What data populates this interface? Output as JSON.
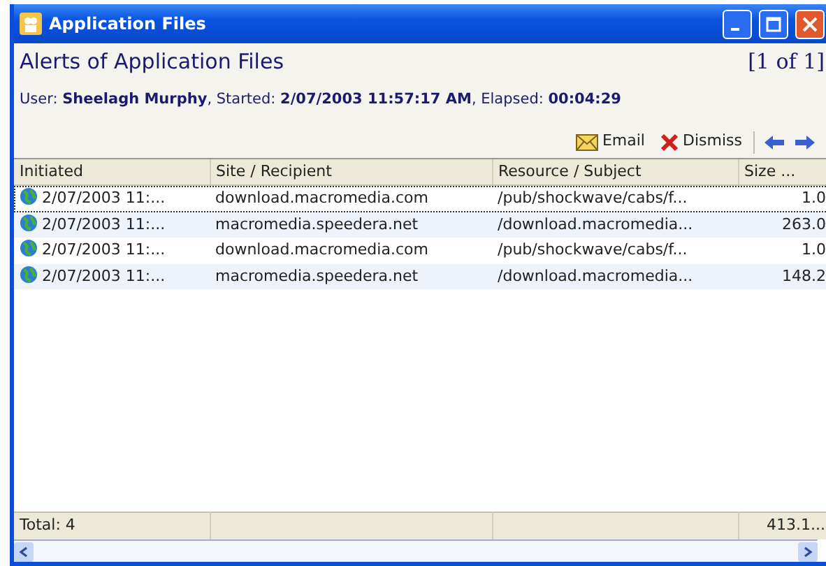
{
  "window": {
    "title": "Application Files"
  },
  "header": {
    "title": "Alerts of Application Files",
    "page": "[1 of 1]"
  },
  "info": "User: **Sheelagh Murphy**, Started: **2/07/2003 11:57:17 AM**, Elapsed: **00:04:29**",
  "toolbar": [
    {
      "kind": "email",
      "label": "Email"
    },
    {
      "kind": "dismiss",
      "label": "Dismiss"
    },
    {
      "kind": "back"
    },
    {
      "kind": "forward"
    }
  ],
  "table": {
    "columns": [
      "Initiated",
      "Site / Recipient",
      "Resource / Subject",
      "Size ..."
    ],
    "rows": [
      {
        "selected": true,
        "cells": [
          "2/07/2003 11:...",
          "download.macromedia.com",
          "/pub/shockwave/cabs/f...",
          "1.0"
        ]
      },
      {
        "selected": false,
        "cells": [
          "2/07/2003 11:...",
          "macromedia.speedera.net",
          "/download.macromedia...",
          "263.0"
        ]
      },
      {
        "selected": false,
        "cells": [
          "2/07/2003 11:...",
          "download.macromedia.com",
          "/pub/shockwave/cabs/f...",
          "1.0"
        ]
      },
      {
        "selected": false,
        "cells": [
          "2/07/2003 11:...",
          "macromedia.speedera.net",
          "/download.macromedia...",
          "148.2"
        ]
      }
    ],
    "footer": {
      "total": "Total: 4",
      "size": "413.1..."
    }
  }
}
